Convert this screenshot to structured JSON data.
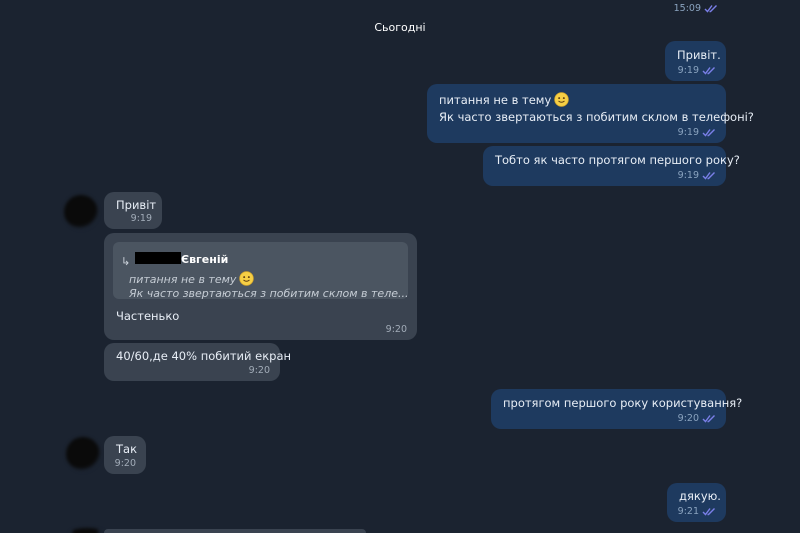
{
  "colors": {
    "background": "#1b2330",
    "outgoing_bubble": "#1e3a5f",
    "incoming_bubble": "#3a4350",
    "reply_box": "#4b5561",
    "read_ticks": "#7a7fe8"
  },
  "top_message": {
    "time": "15:09",
    "status_icon": "double-check-icon"
  },
  "date_separator": "Сьогодні",
  "messages": [
    {
      "lines": [
        "Привіт."
      ],
      "time": "9:19"
    },
    {
      "lines": [
        "питання не в тему",
        "Як часто звертаються з побитим склом в телефоні?"
      ],
      "emoji": "slightly-smiling-face-icon",
      "time": "9:19"
    },
    {
      "lines": [
        "Тобто як часто протягом першого року?"
      ],
      "time": "9:19"
    },
    {
      "lines": [
        "Привіт"
      ],
      "time": "9:19"
    },
    {
      "reply": {
        "author": "Євгеній",
        "quote_line1": "питання не в тему",
        "quote_line2": "Як часто звертаються з побитим склом в теле..."
      },
      "lines": [
        "Частенько"
      ],
      "time": "9:20"
    },
    {
      "lines": [
        "40/60,де 40% побитий екран"
      ],
      "time": "9:20"
    },
    {
      "lines": [
        "протягом першого року користування?"
      ],
      "time": "9:20"
    },
    {
      "lines": [
        "Так"
      ],
      "time": "9:20"
    },
    {
      "lines": [
        "дякую."
      ],
      "time": "9:21"
    }
  ]
}
